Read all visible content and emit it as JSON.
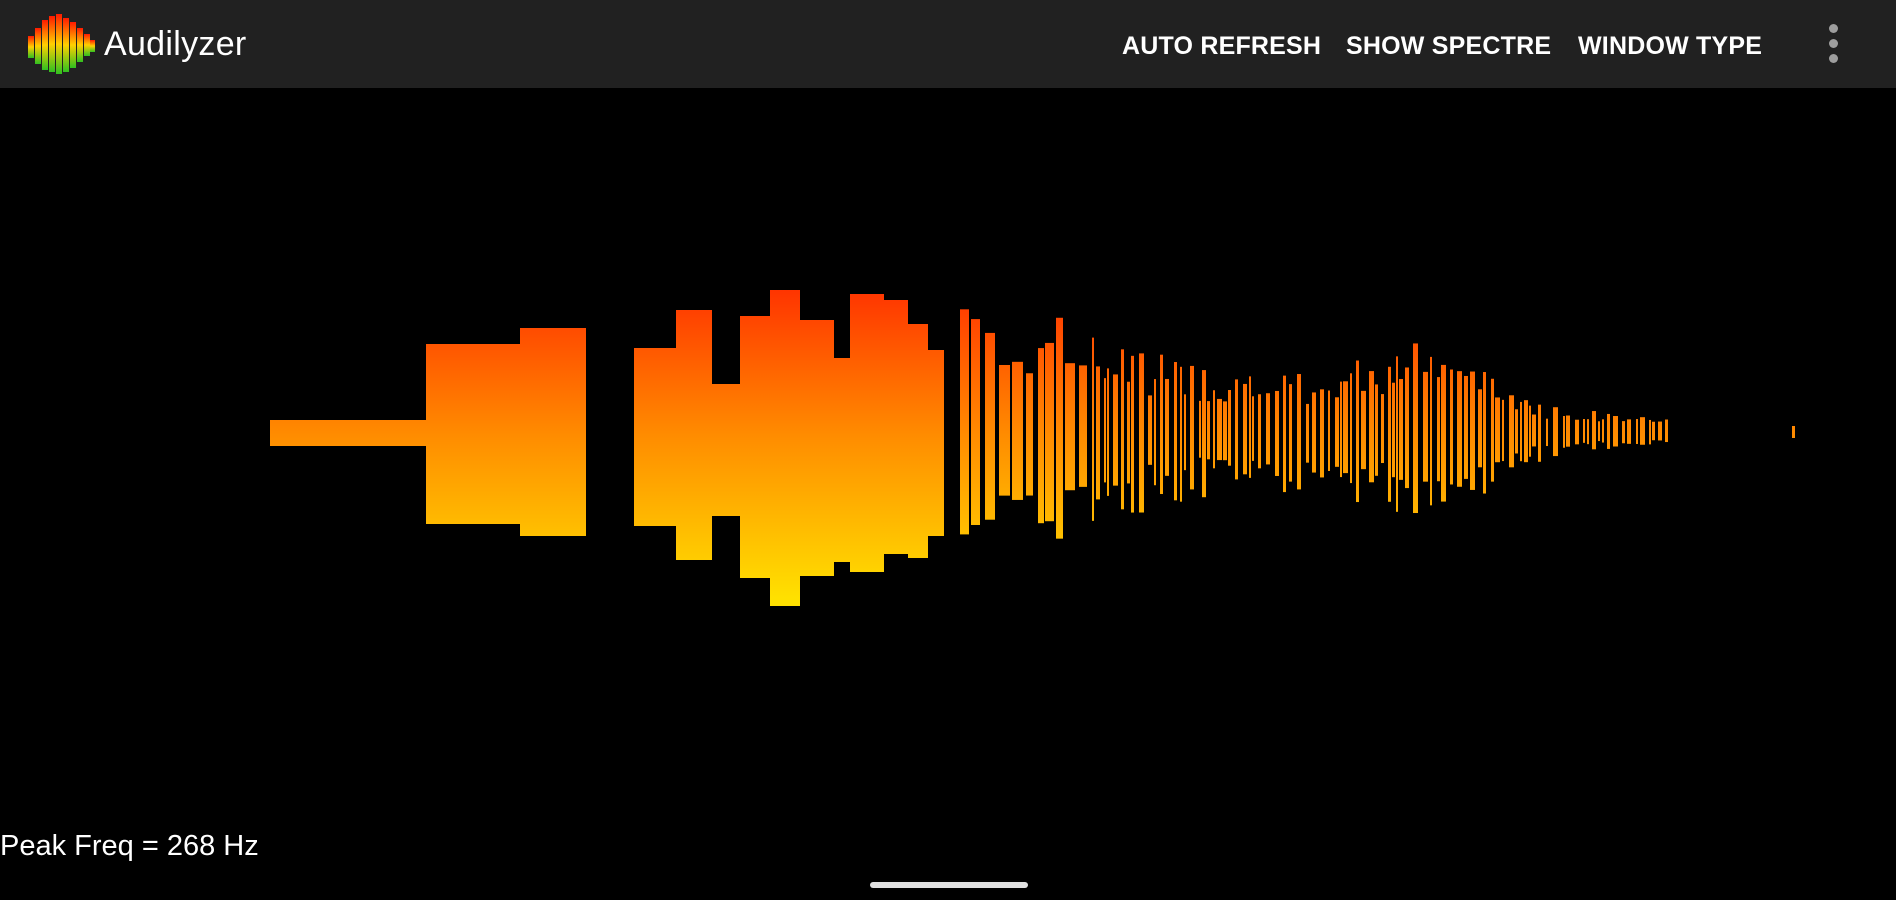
{
  "app": {
    "title": "Audilyzer",
    "logo_icon": "waveform-logo-icon"
  },
  "actions": {
    "auto_refresh": "AUTO REFRESH",
    "show_spectre": "SHOW SPECTRE",
    "window_type": "WINDOW TYPE",
    "overflow_icon": "more-vert-icon"
  },
  "status": {
    "peak_freq": "Peak Freq = 268 Hz"
  },
  "colors": {
    "appbar": "#212121",
    "background": "#000000",
    "wave_top": "#ff2a00",
    "wave_mid": "#ff8c00",
    "wave_bottom": "#ffe000"
  }
}
